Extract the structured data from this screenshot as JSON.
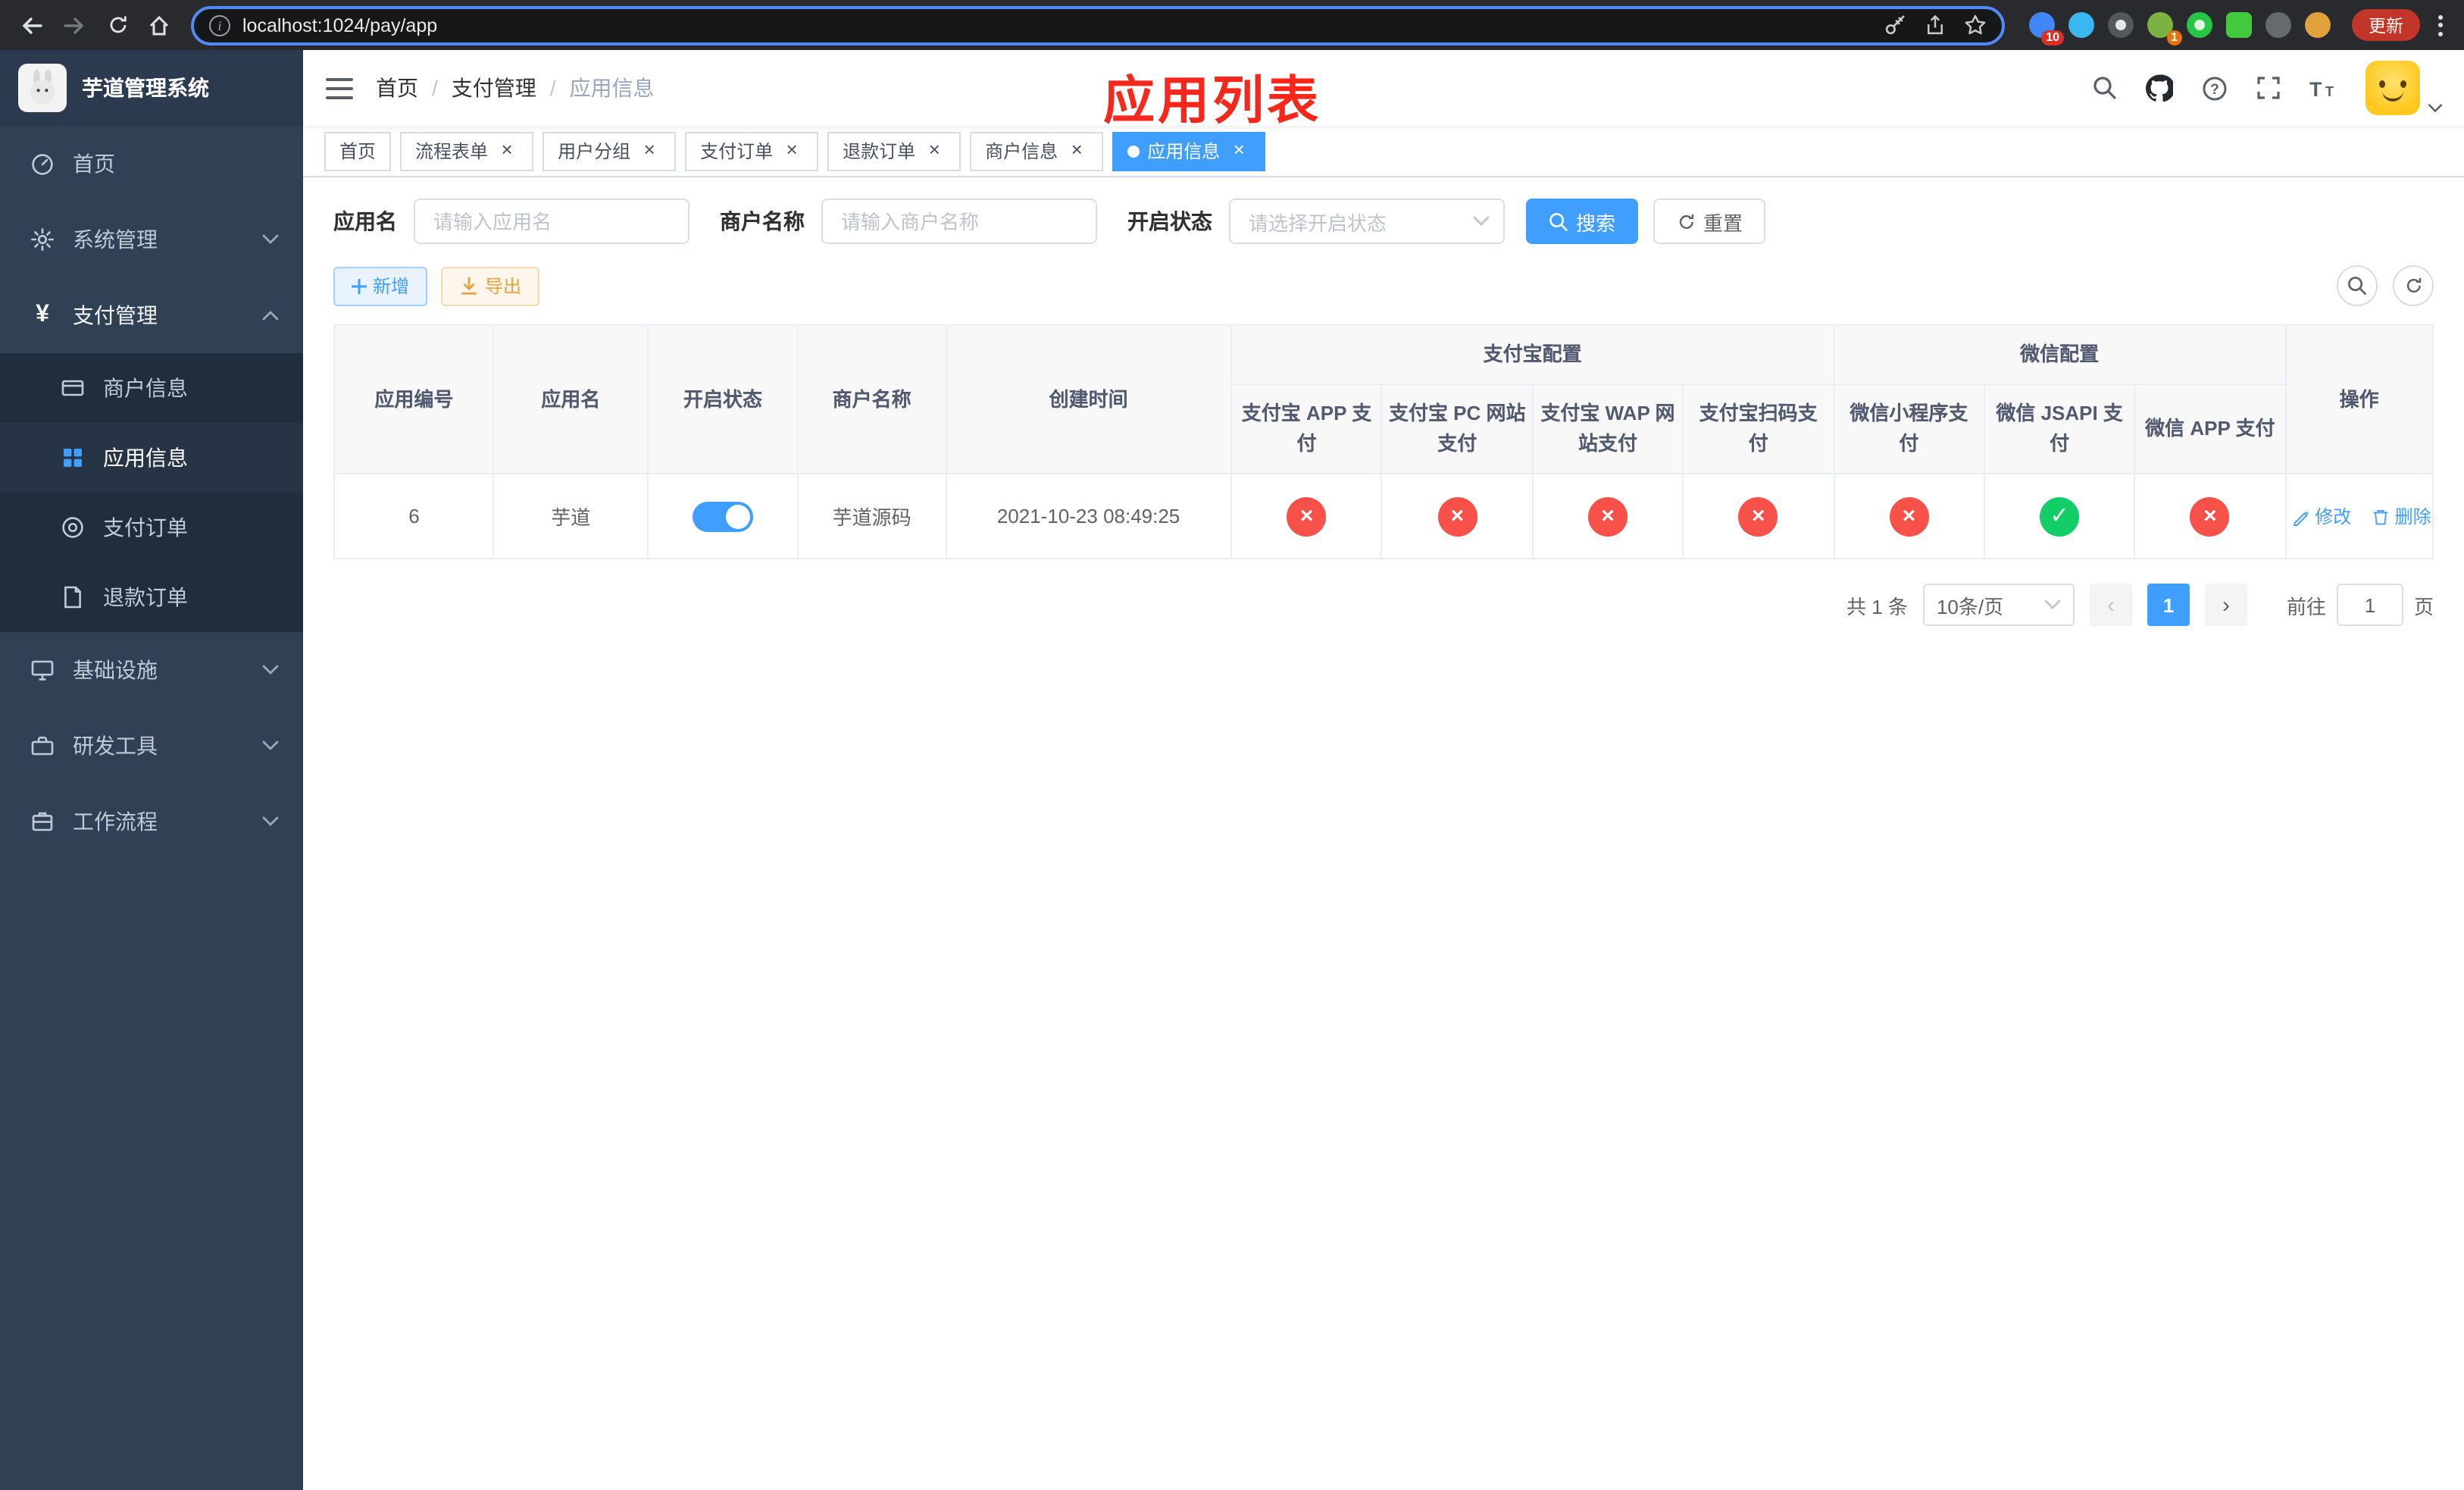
{
  "colors": {
    "accent": "#409EFF",
    "success": "#13ce66",
    "danger": "#f8514a",
    "sidebar_bg": "#304156",
    "submenu_bg": "#1f2d3d"
  },
  "browser": {
    "url": "localhost:1024/pay/app",
    "update_button": "更新",
    "extensions_badge_1": "10",
    "extensions_badge_2": "1"
  },
  "sidebar": {
    "title": "芋道管理系统",
    "items": [
      {
        "label": "首页"
      },
      {
        "label": "系统管理"
      },
      {
        "label": "支付管理"
      },
      {
        "label": "商户信息"
      },
      {
        "label": "应用信息"
      },
      {
        "label": "支付订单"
      },
      {
        "label": "退款订单"
      },
      {
        "label": "基础设施"
      },
      {
        "label": "研发工具"
      },
      {
        "label": "工作流程"
      }
    ]
  },
  "navbar": {
    "breadcrumb": [
      {
        "label": "首页"
      },
      {
        "label": "支付管理"
      },
      {
        "label": "应用信息"
      }
    ]
  },
  "annotation": {
    "title": "应用列表"
  },
  "tabs": [
    {
      "label": "首页",
      "closable": false,
      "active": false
    },
    {
      "label": "流程表单",
      "closable": true,
      "active": false
    },
    {
      "label": "用户分组",
      "closable": true,
      "active": false
    },
    {
      "label": "支付订单",
      "closable": true,
      "active": false
    },
    {
      "label": "退款订单",
      "closable": true,
      "active": false
    },
    {
      "label": "商户信息",
      "closable": true,
      "active": false
    },
    {
      "label": "应用信息",
      "closable": true,
      "active": true
    }
  ],
  "filters": {
    "app_name": {
      "label": "应用名",
      "placeholder": "请输入应用名",
      "value": ""
    },
    "merchant_name": {
      "label": "商户名称",
      "placeholder": "请输入商户名称",
      "value": ""
    },
    "status": {
      "label": "开启状态",
      "placeholder": "请选择开启状态",
      "value": ""
    },
    "search_button": "搜索",
    "reset_button": "重置"
  },
  "toolbar": {
    "add_button": "新增",
    "export_button": "导出"
  },
  "table": {
    "columns": {
      "app_id": "应用编号",
      "app_name": "应用名",
      "status": "开启状态",
      "merchant": "商户名称",
      "created_at": "创建时间",
      "alipay_group": "支付宝配置",
      "alipay_app": "支付宝 APP 支付",
      "alipay_pc": "支付宝 PC 网站支付",
      "alipay_wap": "支付宝 WAP 网站支付",
      "alipay_qr": "支付宝扫码支付",
      "wechat_group": "微信配置",
      "wechat_mini": "微信小程序支付",
      "wechat_jsapi": "微信 JSAPI 支付",
      "wechat_app": "微信 APP 支付",
      "actions": "操作"
    },
    "rows": [
      {
        "app_id": "6",
        "app_name": "芋道",
        "enabled": true,
        "merchant": "芋道源码",
        "created_at": "2021-10-23 08:49:25",
        "alipay_app": false,
        "alipay_pc": false,
        "alipay_wap": false,
        "alipay_qr": false,
        "wechat_mini": false,
        "wechat_jsapi": true,
        "wechat_app": false,
        "edit_button": "修改",
        "delete_button": "删除"
      }
    ]
  },
  "pagination": {
    "total": "共 1 条",
    "page_size": "10条/页",
    "prev": "‹",
    "page": "1",
    "next": "›",
    "goto_label": "前往",
    "goto_value": "1",
    "goto_unit": "页"
  }
}
